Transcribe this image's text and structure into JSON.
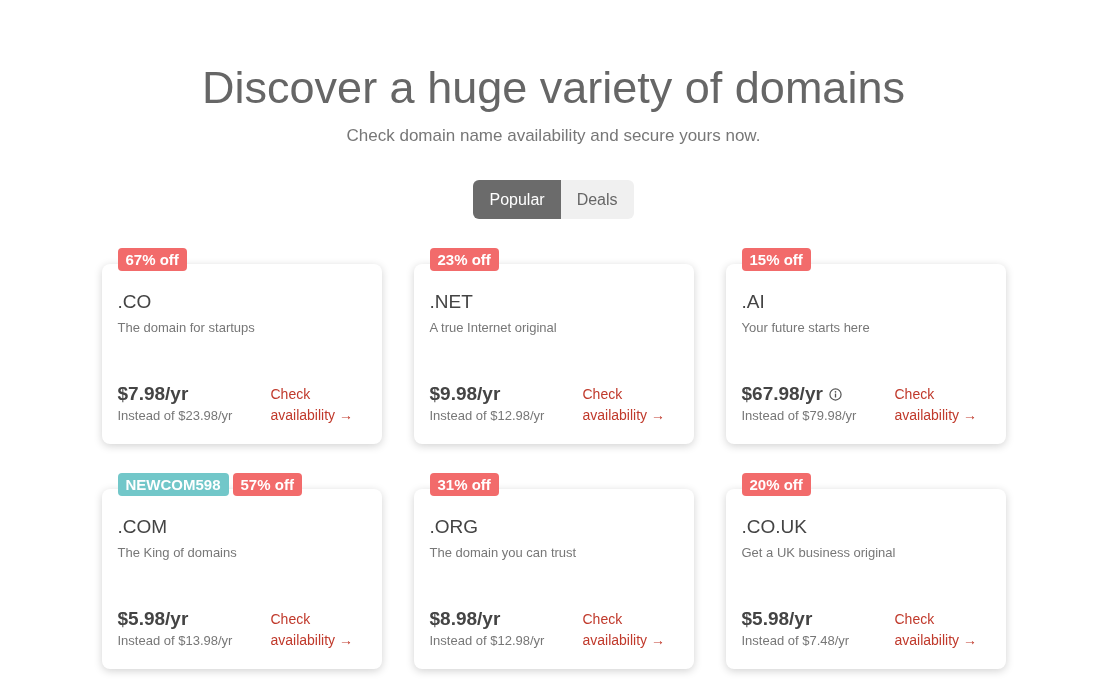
{
  "heading": "Discover a huge variety of domains",
  "subheading": "Check domain name availability and secure yours now.",
  "tabs": [
    {
      "label": "Popular",
      "selected": true
    },
    {
      "label": "Deals",
      "selected": false
    }
  ],
  "cards": [
    {
      "kind": "plain",
      "badges": [
        {
          "kind": "discount",
          "text": "67% off"
        }
      ],
      "domain": ".CO",
      "tagline": "The domain for startups",
      "price": "$7.98/yr",
      "old_price": "Instead of $23.98/yr",
      "link": "Check availability →"
    },
    {
      "kind": "plain",
      "badges": [
        {
          "kind": "discount",
          "text": "23% off"
        }
      ],
      "domain": ".NET",
      "tagline": "A true Internet original",
      "price": "$9.98/yr",
      "old_price": "Instead of $12.98/yr",
      "link": "Check availability →"
    },
    {
      "kind": "info",
      "badges": [
        {
          "kind": "discount",
          "text": "15% off"
        }
      ],
      "domain": ".AI",
      "tagline": "Your future starts here",
      "price": "$67.98/yr",
      "old_price": "Instead of $79.98/yr",
      "link": "Check availability →"
    },
    {
      "kind": "plain",
      "badges": [
        {
          "kind": "coupon",
          "text": "NEWCOM598"
        },
        {
          "kind": "discount",
          "text": "57% off"
        }
      ],
      "domain": ".COM",
      "tagline": "The King of domains",
      "price": "$5.98/yr",
      "old_price": "Instead of $13.98/yr",
      "link": "Check availability →"
    },
    {
      "kind": "plain",
      "badges": [
        {
          "kind": "discount",
          "text": "31% off"
        }
      ],
      "domain": ".ORG",
      "tagline": "The domain you can trust",
      "price": "$8.98/yr",
      "old_price": "Instead of $12.98/yr",
      "link": "Check availability →"
    },
    {
      "kind": "plain",
      "badges": [
        {
          "kind": "discount",
          "text": "20% off"
        }
      ],
      "domain": ".CO.UK",
      "tagline": "Get a UK business original",
      "price": "$5.98/yr",
      "old_price": "Instead of $7.48/yr",
      "link": "Check availability →"
    }
  ]
}
